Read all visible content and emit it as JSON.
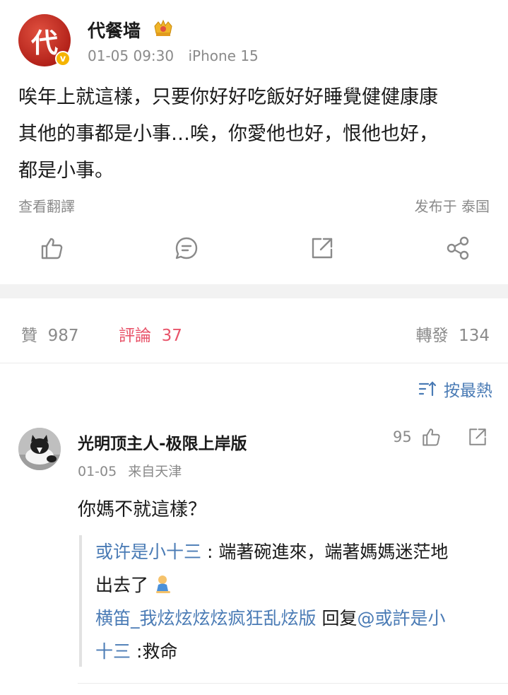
{
  "post": {
    "avatar_glyph": "代",
    "author": "代餐墙",
    "date": "01-05 09:30",
    "device": "iPhone 15",
    "body_lines": [
      "唉年上就這樣，只要你好好吃飯好好睡覺健健康康",
      "其他的事都是小事…唉，你愛他也好，恨他也好，",
      "都是小事。"
    ],
    "translate_label": "查看翻譯",
    "location": "发布于 泰国",
    "actions": [
      "like-icon",
      "comment-icon",
      "repost-icon",
      "share-icon"
    ]
  },
  "stats": {
    "likes_label": "贊",
    "likes": "987",
    "comments_label": "評論",
    "comments": "37",
    "reposts_label": "轉發",
    "reposts": "134",
    "accent_color": "#e8546a"
  },
  "sort": {
    "label": "按最熱"
  },
  "comment": {
    "author": "光明顶主人-极限上岸版",
    "date": "01-05",
    "location": "来自天津",
    "likes": "95",
    "text": "你媽不就這樣？",
    "replies": [
      {
        "user": "或许是小十三",
        "sep": " : ",
        "text_line1": "端著碗進來，端著媽媽迷茫地",
        "text_line2": "出去了",
        "emoji": "kneeling-emoji"
      },
      {
        "user": "横笛_我炫炫炫炫疯狂乱炫版",
        "reply_word": " 回复",
        "mention_line1": "@或許是小",
        "mention_line2": "十三",
        "text": " :救命"
      }
    ]
  },
  "colors": {
    "link": "#4a7bb5",
    "muted": "#8a8a8a",
    "verified": "#f5b400"
  }
}
